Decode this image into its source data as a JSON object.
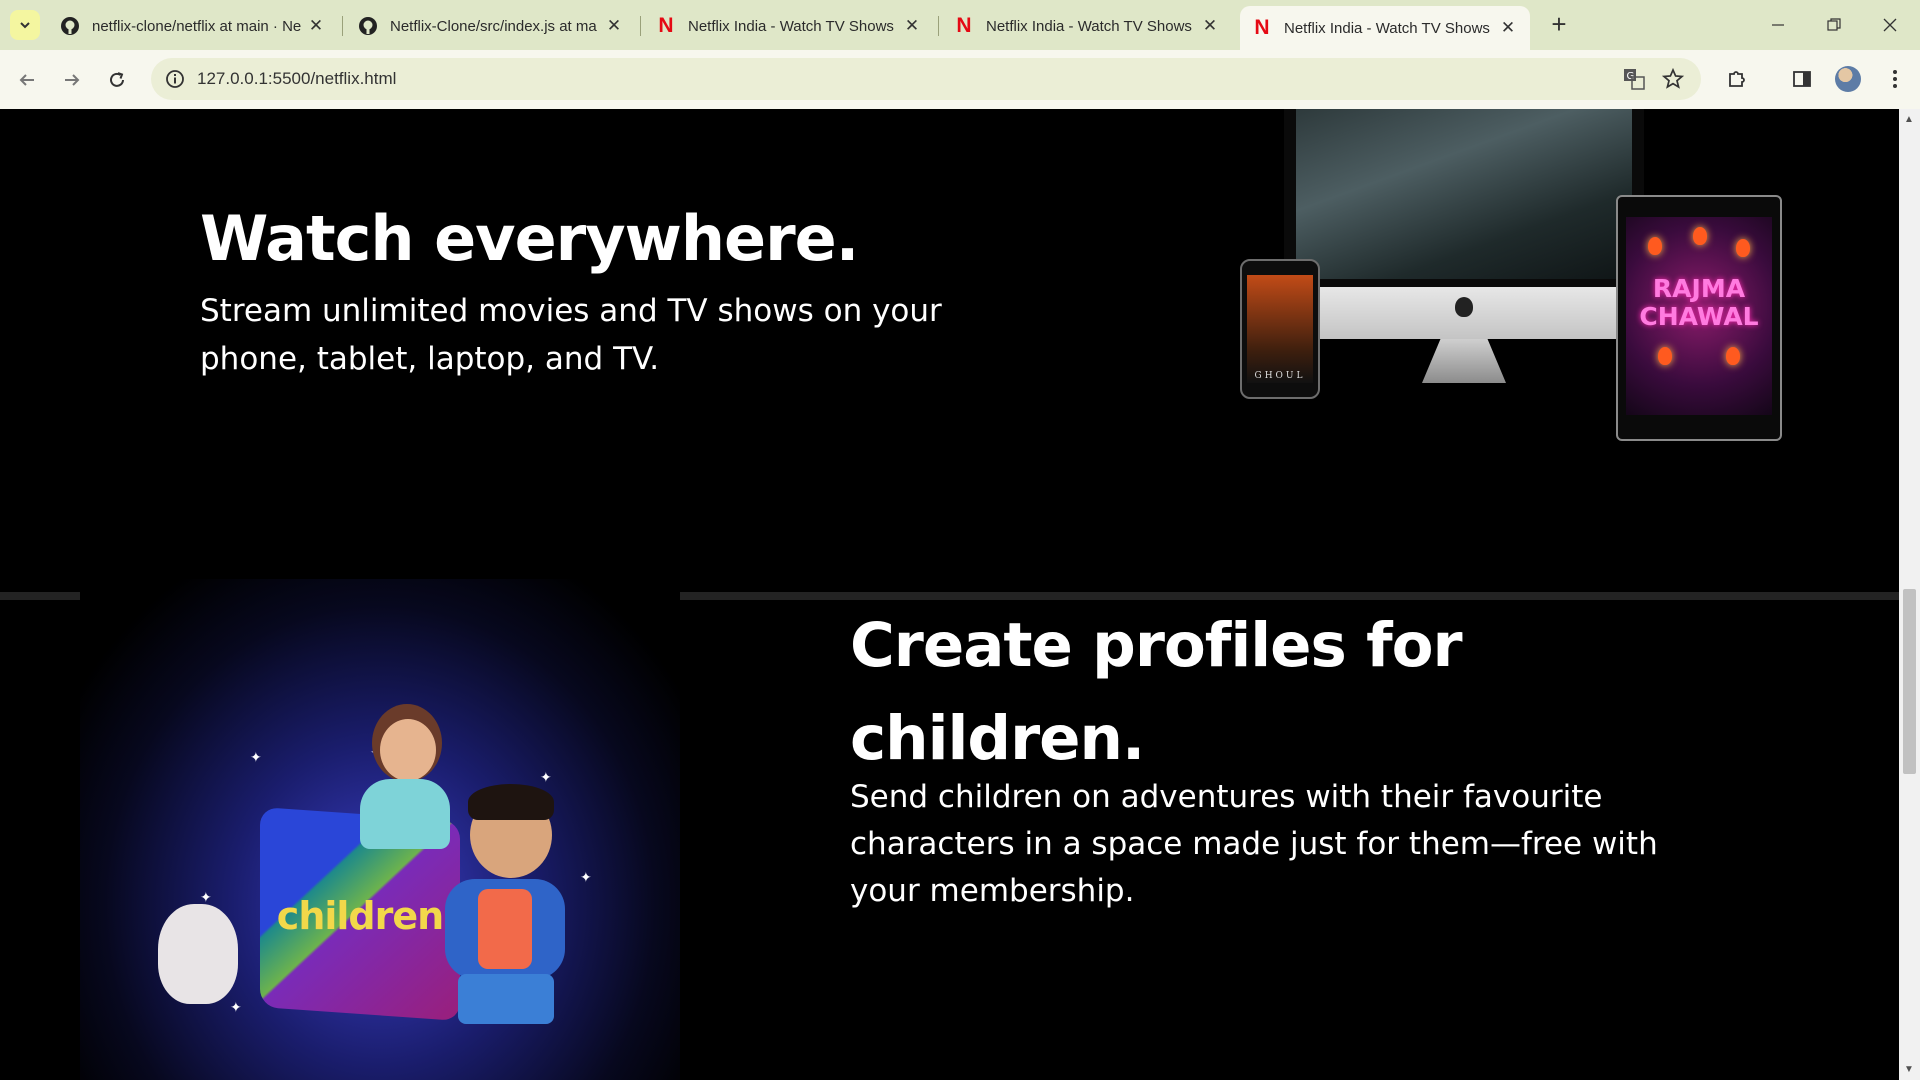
{
  "browser": {
    "tabs": [
      {
        "title": "netflix-clone/netflix at main · Ne",
        "icon": "github-icon",
        "active": false
      },
      {
        "title": "Netflix-Clone/src/index.js at ma",
        "icon": "github-icon",
        "active": false
      },
      {
        "title": "Netflix India - Watch TV Shows",
        "icon": "netflix-icon",
        "active": false
      },
      {
        "title": "Netflix India - Watch TV Shows",
        "icon": "netflix-icon",
        "active": false
      },
      {
        "title": "Netflix India - Watch TV Shows",
        "icon": "netflix-icon",
        "active": true
      }
    ],
    "new_tab_label": "+",
    "url": "127.0.0.1:5500/netflix.html",
    "close_glyph": "✕",
    "netflix_glyph": "N"
  },
  "sections": {
    "watch": {
      "title": "Watch everywhere.",
      "text": "Stream unlimited movies and TV shows on your phone, tablet, laptop, and TV.",
      "phone_label": "GHOUL",
      "tablet_label": "RAJMA CHAWAL"
    },
    "kids": {
      "title": "Create profiles for children.",
      "text": "Send children on adventures with their favourite characters in a space made just for them—free with your membership.",
      "card_label": "children"
    }
  },
  "colors": {
    "netflix_red": "#e50914",
    "tabbar_bg": "#dfe7c8",
    "toolbar_bg": "#f7f7ee",
    "page_bg": "#000000",
    "divider": "#232323"
  }
}
